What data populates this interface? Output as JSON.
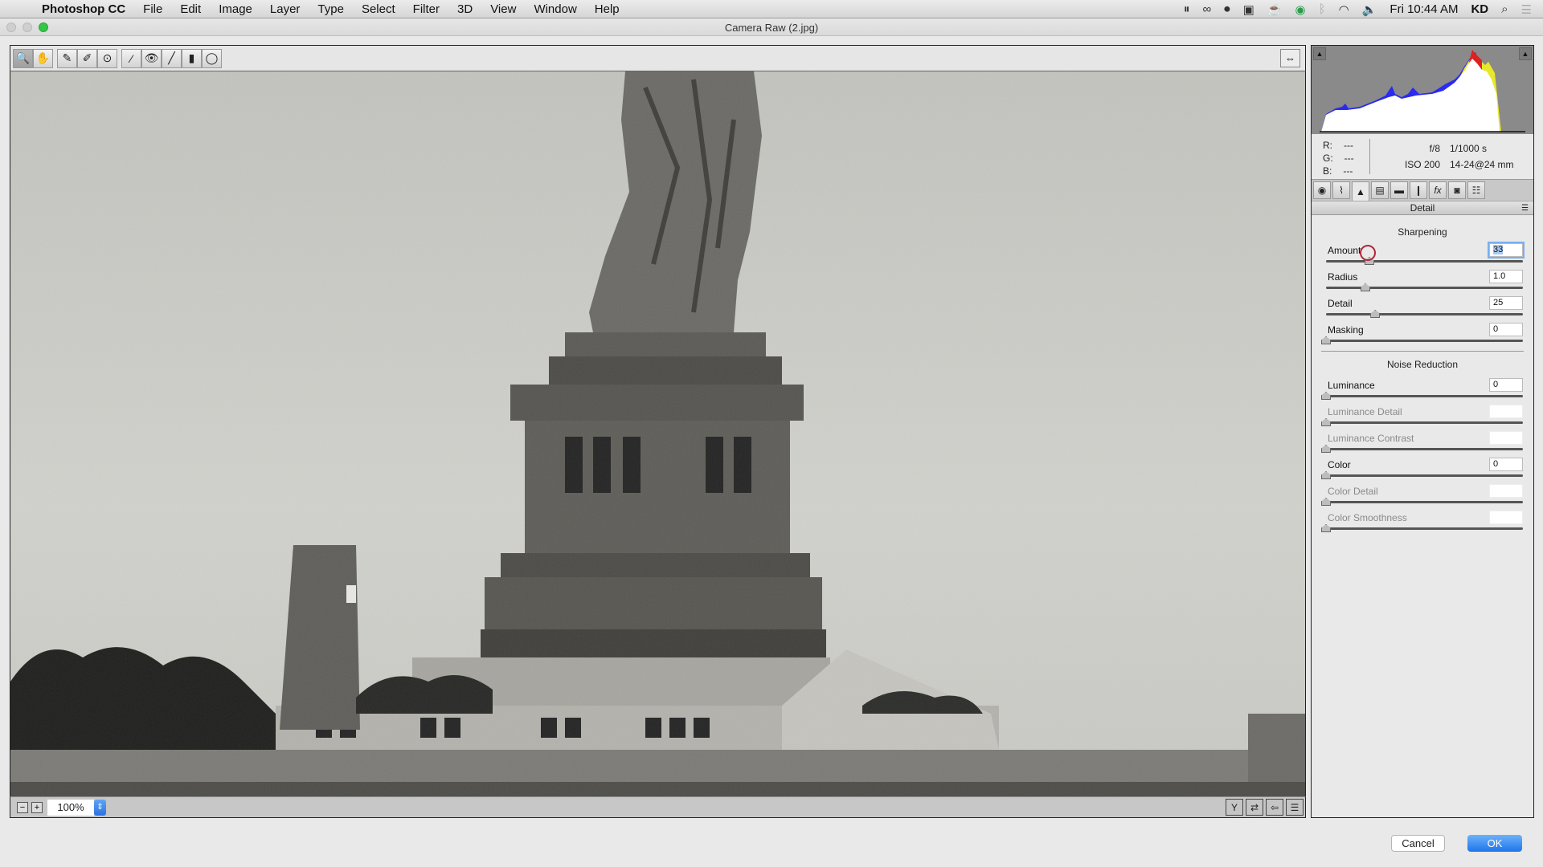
{
  "menubar": {
    "apple_icon": "apple-logo",
    "app_name": "Photoshop CC",
    "items": [
      "File",
      "Edit",
      "Image",
      "Layer",
      "Type",
      "Select",
      "Filter",
      "3D",
      "View",
      "Window",
      "Help"
    ],
    "status_icons": [
      "sync-paused-icon",
      "creative-cloud-icon",
      "screen-record-icon",
      "screen-share-icon",
      "caffeine-icon",
      "sync-check-icon",
      "bluetooth-icon",
      "wifi-icon",
      "volume-icon"
    ],
    "clock": "Fri 10:44 AM",
    "user": "KD",
    "search_icon": "spotlight-search-icon",
    "notifications_icon": "notification-center-icon"
  },
  "window": {
    "title": "Camera Raw (2.jpg)"
  },
  "toolbar": {
    "tools": [
      {
        "name": "zoom-tool",
        "glyph": "🔍",
        "active": true
      },
      {
        "name": "hand-tool",
        "glyph": "✋",
        "active": false
      },
      {
        "name": "white-balance-tool",
        "glyph": "✎",
        "active": false
      },
      {
        "name": "color-sampler-tool",
        "glyph": "✐",
        "active": false
      },
      {
        "name": "targeted-adjustment-tool",
        "glyph": "⊙",
        "active": false
      },
      {
        "name": "spot-removal-tool",
        "glyph": "⁄",
        "active": false
      },
      {
        "name": "red-eye-tool",
        "glyph": "👁",
        "active": false
      },
      {
        "name": "adjustment-brush-tool",
        "glyph": "╱",
        "active": false
      },
      {
        "name": "graduated-filter-tool",
        "glyph": "▮",
        "active": false
      },
      {
        "name": "radial-filter-tool",
        "glyph": "◯",
        "active": false
      }
    ],
    "fullscreen_glyph": "⇔"
  },
  "bottombar": {
    "zoom_out": "−",
    "zoom_in": "+",
    "zoom_level": "100%",
    "stepper": "⇕",
    "view_buttons": [
      "Y",
      "⇄",
      "⇦",
      "☰"
    ]
  },
  "histogram": {
    "clip_shadow_glyph": "▲",
    "clip_highlight_glyph": "▲"
  },
  "info": {
    "r_label": "R:",
    "r_value": "---",
    "g_label": "G:",
    "g_value": "---",
    "b_label": "B:",
    "b_value": "---",
    "aperture": "f/8",
    "shutter": "1/1000 s",
    "iso": "ISO 200",
    "lens": "14-24@24 mm"
  },
  "panel_tabs": [
    {
      "name": "basic-tab",
      "glyph": "◉"
    },
    {
      "name": "tone-curve-tab",
      "glyph": "⌇"
    },
    {
      "name": "detail-tab",
      "glyph": "▲",
      "active": true
    },
    {
      "name": "hsl-tab",
      "glyph": "▤"
    },
    {
      "name": "split-toning-tab",
      "glyph": "▬"
    },
    {
      "name": "lens-corrections-tab",
      "glyph": "❙"
    },
    {
      "name": "effects-tab",
      "glyph": "fx"
    },
    {
      "name": "camera-calibration-tab",
      "glyph": "◙"
    },
    {
      "name": "presets-tab",
      "glyph": "☷"
    }
  ],
  "panel": {
    "title": "Detail",
    "menu_glyph": "☰",
    "sharpening": {
      "title": "Sharpening",
      "sliders": [
        {
          "label": "Amount",
          "value": "33",
          "fraction": 0.22,
          "disabled": false,
          "selected": true
        },
        {
          "label": "Radius",
          "value": "1.0",
          "fraction": 0.2,
          "disabled": false,
          "selected": false
        },
        {
          "label": "Detail",
          "value": "25",
          "fraction": 0.25,
          "disabled": false,
          "selected": false
        },
        {
          "label": "Masking",
          "value": "0",
          "fraction": 0.0,
          "disabled": false,
          "selected": false
        }
      ]
    },
    "noise_reduction": {
      "title": "Noise Reduction",
      "sliders": [
        {
          "label": "Luminance",
          "value": "0",
          "fraction": 0.0,
          "disabled": false
        },
        {
          "label": "Luminance Detail",
          "value": "",
          "fraction": 0.0,
          "disabled": true
        },
        {
          "label": "Luminance Contrast",
          "value": "",
          "fraction": 0.0,
          "disabled": true
        },
        {
          "label": "Color",
          "value": "0",
          "fraction": 0.0,
          "disabled": false
        },
        {
          "label": "Color Detail",
          "value": "",
          "fraction": 0.0,
          "disabled": true
        },
        {
          "label": "Color Smoothness",
          "value": "",
          "fraction": 0.0,
          "disabled": true
        }
      ]
    }
  },
  "buttons": {
    "cancel": "Cancel",
    "ok": "OK"
  },
  "colors": {
    "accent": "#2a72e0",
    "cursor_ring": "#b0283a"
  }
}
